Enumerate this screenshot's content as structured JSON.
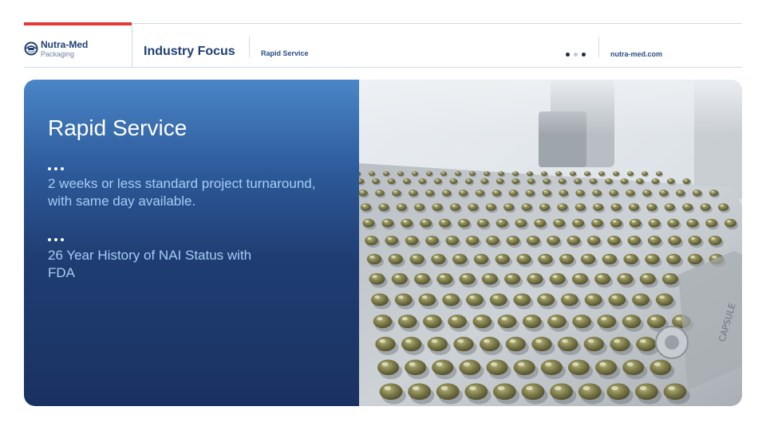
{
  "header": {
    "brand_name": "Nutra-Med",
    "brand_sub": "Packaging",
    "section_title": "Industry Focus",
    "section_subtitle": "Rapid Service",
    "website": "nutra-med.com",
    "pager": [
      "active",
      "inactive",
      "active"
    ]
  },
  "main": {
    "title": "Rapid Service",
    "bullets": [
      {
        "text": "2 weeks or less standard project turnaround, with same day available."
      },
      {
        "text": "26 Year History of NAI Status with FDA"
      }
    ]
  },
  "photo": {
    "subject": "capsule-filling-plate",
    "plate_engraving": "CAPSULE"
  },
  "colors": {
    "accent_red": "#e23a3a",
    "brand_navy": "#1f3f75",
    "panel_top": "#4a86c8",
    "panel_bottom": "#1a3262",
    "bullet_text": "#a6cdf5",
    "capsule_olive": "#7e7c4a"
  }
}
